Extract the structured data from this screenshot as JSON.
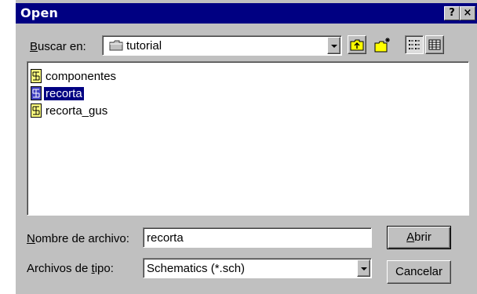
{
  "dialog": {
    "title": "Open",
    "help_button": "?",
    "close_button": "×"
  },
  "look_in": {
    "label_prefix": "",
    "label_accel": "B",
    "label_rest": "uscar en:",
    "value": "tutorial",
    "folder_icon": "folder-icon"
  },
  "toolbar": {
    "up_folder_icon": "up-one-level-icon",
    "new_folder_icon": "create-new-folder-icon",
    "list_view_icon": "list-view-icon",
    "details_view_icon": "details-view-icon",
    "active_view": "list"
  },
  "files": [
    {
      "name": "componentes",
      "icon": "schematic-file-icon",
      "selected": false
    },
    {
      "name": "recorta",
      "icon": "schematic-file-icon",
      "selected": true
    },
    {
      "name": "recorta_gus",
      "icon": "schematic-file-icon",
      "selected": false
    }
  ],
  "filename": {
    "label_accel": "N",
    "label_rest": "ombre de archivo:",
    "value": "recorta"
  },
  "filetype": {
    "label_prefix": "Archivos de ",
    "label_accel": "t",
    "label_rest": "ipo:",
    "value": "Schematics (*.sch)"
  },
  "buttons": {
    "open_accel": "A",
    "open_rest": "brir",
    "cancel": "Cancelar"
  },
  "colors": {
    "titlebar": "#000082",
    "face": "#c0c0c0",
    "selection": "#000082"
  }
}
